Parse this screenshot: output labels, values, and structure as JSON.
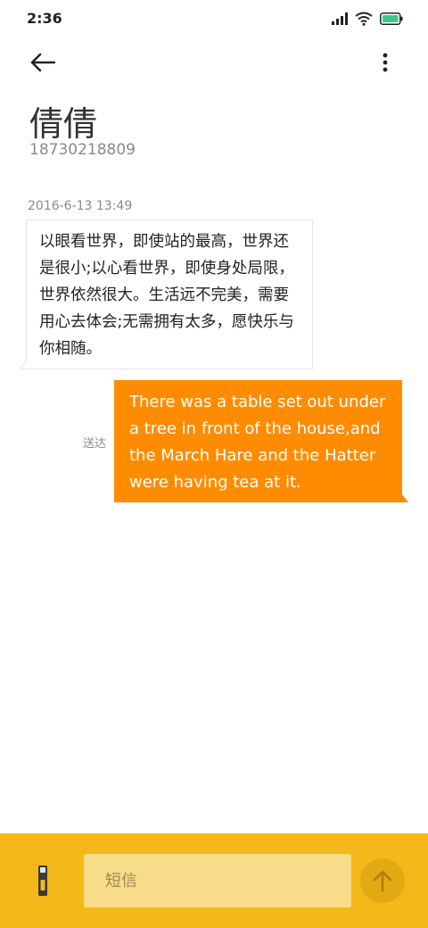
{
  "status_bar": {
    "time": "2:36"
  },
  "contact": {
    "name": "倩倩",
    "number": "18730218809"
  },
  "conversation": {
    "timestamp": "2016-6-13 13:49",
    "messages": [
      {
        "direction": "incoming",
        "text": "以眼看世界，即使站的最高，世界还是很小;以心看世界，即使身处局限，世界依然很大。生活远不完美，需要用心去体会;无需拥有太多，愿快乐与你相随。"
      },
      {
        "direction": "outgoing",
        "text": "There was a table set out under a tree in front of the house,and the March Hare and the Hatter were having tea at it.",
        "status": "送达"
      }
    ]
  },
  "composer": {
    "placeholder": "短信"
  },
  "colors": {
    "outgoing_bubble": "#ff8c00",
    "bottom_bar": "#f4b81a",
    "input_bg": "#f9dc89",
    "send_button": "#e2a915"
  },
  "icons": {
    "back": "arrow-left-icon",
    "more": "more-vertical-icon",
    "signal": "signal-icon",
    "wifi": "wifi-icon",
    "battery": "battery-icon",
    "attach": "usb-icon",
    "send": "arrow-up-icon"
  }
}
